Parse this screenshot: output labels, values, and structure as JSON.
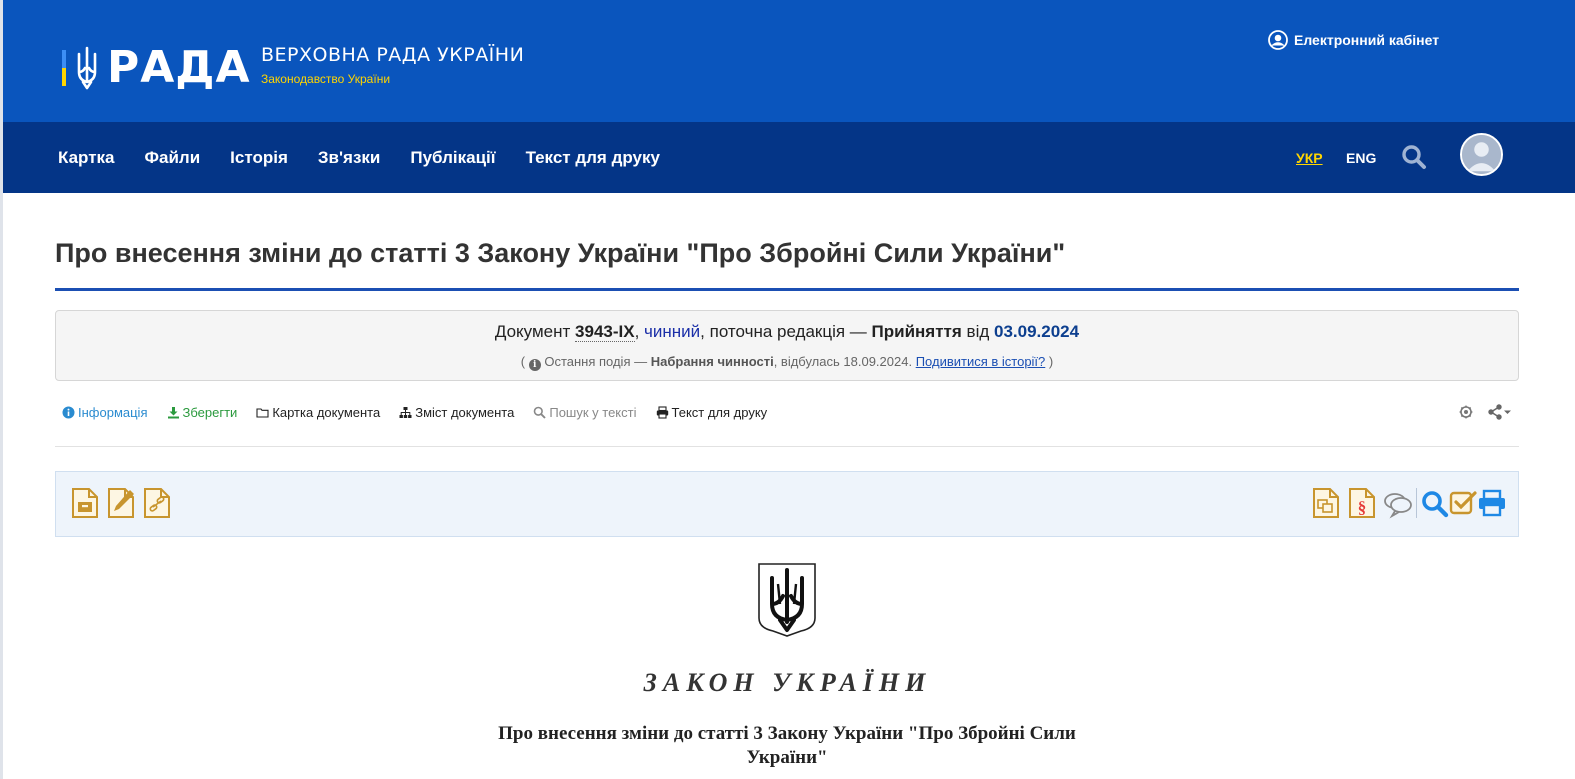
{
  "header": {
    "brand_name": "РАДА",
    "brand_title": "ВЕРХОВНА РАДА УКРАЇНИ",
    "brand_subtitle": "Законодавство України",
    "cabinet_label": "Електронний кабінет",
    "icons": {
      "logo": "trident-icon",
      "cabinet": "user-circle-icon"
    }
  },
  "nav": {
    "items": [
      "Картка",
      "Файли",
      "Історія",
      "Зв'язки",
      "Публікації",
      "Текст для друку"
    ],
    "lang_ukr": "УКР",
    "lang_eng": "ENG",
    "icons": {
      "search": "search-icon",
      "avatar": "avatar-icon"
    }
  },
  "document": {
    "title": "Про внесення зміни до статті 3 Закону України \"Про Збройні Сили України\"",
    "status": {
      "prefix": "Документ",
      "number": "3943-IX",
      "state": "чинний",
      "middle": ", поточна редакція —",
      "adopted_label": "Прийняття",
      "from_label": "від",
      "date": "03.09.2024"
    },
    "event": {
      "open_paren": "(",
      "label": "Остання подія —",
      "name": "Набрання чинності",
      "happened": ", відбулась",
      "date": "18.09.2024.",
      "history_link": "Подивитися в історії?",
      "close_paren": ")"
    }
  },
  "toolbar": {
    "items": [
      "Інформація",
      "Зберегти",
      "Картка документа",
      "Зміст документа",
      "Пошук у тексті",
      "Текст для друку"
    ],
    "icons": [
      "info-icon",
      "download-icon",
      "folder-icon",
      "sitemap-icon",
      "search-icon",
      "print-icon",
      "settings-icon",
      "share-icon"
    ]
  },
  "panel": {
    "left_icons": [
      "archive-doc-icon",
      "edit-doc-icon",
      "link-doc-icon"
    ],
    "right_icons": [
      "compare-doc-icon",
      "paragraph-doc-icon",
      "comments-icon",
      "search-icon",
      "check-icon",
      "print-icon"
    ],
    "colors": {
      "gold": "#c8952e",
      "blue": "#1e88e5",
      "red": "#e53935"
    }
  },
  "law": {
    "emblem": "coat-of-arms-icon",
    "heading": "ЗАКОН УКРАЇНИ",
    "subtitle": "Про внесення зміни до статті 3 Закону України \"Про Збройні Сили України\""
  },
  "colors": {
    "header_blue": "#0a55bd",
    "nav_blue": "#043587",
    "accent_yellow": "#ffd500",
    "title_rule": "#1b4fb3"
  }
}
